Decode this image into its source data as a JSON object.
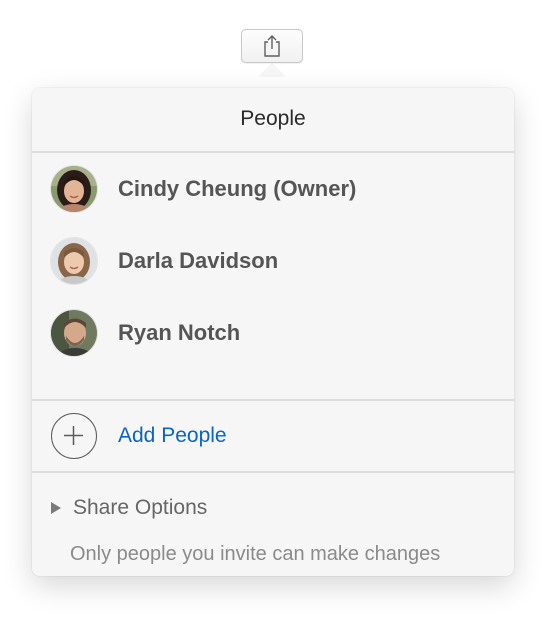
{
  "toolbar": {
    "share_icon": "share-icon"
  },
  "popover": {
    "title": "People",
    "people": [
      {
        "name": "Cindy Cheung (Owner)",
        "avatar": "avatar-cindy"
      },
      {
        "name": "Darla Davidson",
        "avatar": "avatar-darla"
      },
      {
        "name": "Ryan Notch",
        "avatar": "avatar-ryan"
      }
    ],
    "add_people_label": "Add People",
    "add_icon": "plus-circle-icon",
    "share_options_label": "Share Options",
    "share_options_icon": "disclosure-triangle-icon",
    "share_options_description": "Only people you invite can make changes"
  },
  "colors": {
    "accent": "#0a64c8",
    "name_text": "#555555",
    "popover_bg": "#f6f6f6",
    "divider": "#dcdcdc"
  }
}
